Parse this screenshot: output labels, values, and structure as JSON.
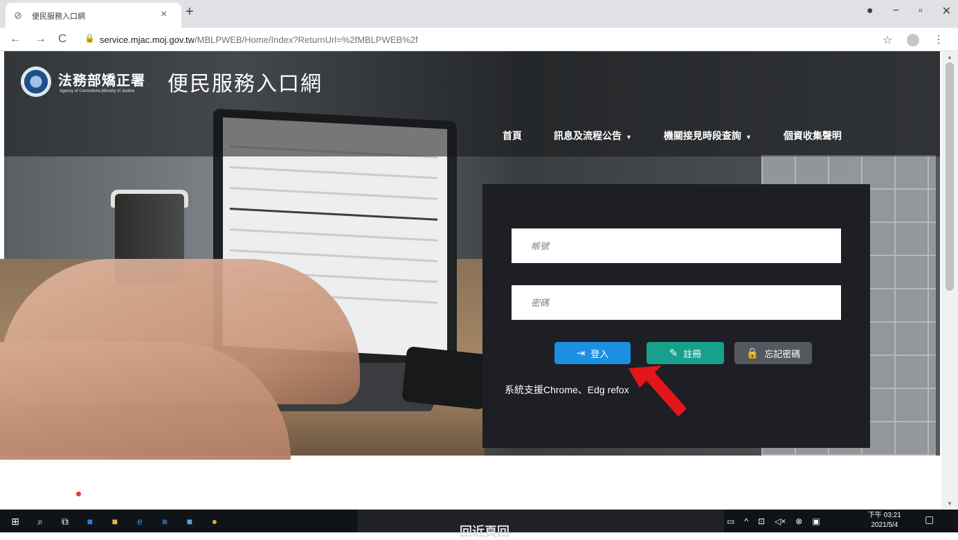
{
  "browser": {
    "tab_title": "便民服務入口網",
    "url_host": "service.mjac.moj.gov.tw",
    "url_path": "/MBLPWEB/Home/Index?ReturnUrl=%2fMBLPWEB%2f"
  },
  "header": {
    "org_name": "法務部矯正署",
    "org_name_en": "Agency of Corrections,Ministry of Justice",
    "portal_title": "便民服務入口網"
  },
  "nav": {
    "home": "首頁",
    "announcements": "訊息及流程公告",
    "visit_schedule": "機關接見時段查詢",
    "privacy": "個資收集聲明"
  },
  "login": {
    "account_placeholder": "帳號",
    "password_placeholder": "密碼",
    "login_label": "登入",
    "register_label": "註冊",
    "forgot_label": "忘記密碼",
    "support_note": "系統支援Chrome、Edg    refox"
  },
  "taskbar": {
    "preview_text": "回近頁回",
    "time": "下午 03:21",
    "date": "2021/5/4"
  },
  "colors": {
    "login_blue": "#1b8fe0",
    "register_teal": "#17a08c",
    "forgot_gray": "#55585e",
    "panel_bg": "#1d1f24",
    "arrow_red": "#e3161b"
  }
}
